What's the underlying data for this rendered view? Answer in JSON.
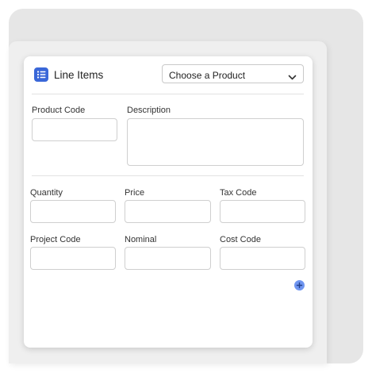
{
  "header": {
    "title": "Line Items",
    "icon": "list-icon",
    "accent_color": "#3a67d8"
  },
  "product_select": {
    "selected": "Choose a Product",
    "icon": "chevron-down-icon"
  },
  "fields": {
    "product_code": {
      "label": "Product Code",
      "value": ""
    },
    "description": {
      "label": "Description",
      "value": ""
    },
    "quantity": {
      "label": "Quantity",
      "value": ""
    },
    "price": {
      "label": "Price",
      "value": ""
    },
    "tax_code": {
      "label": "Tax Code",
      "value": ""
    },
    "project_code": {
      "label": "Project Code",
      "value": ""
    },
    "nominal": {
      "label": "Nominal",
      "value": ""
    },
    "cost_code": {
      "label": "Cost Code",
      "value": ""
    }
  },
  "add_button": {
    "icon": "plus-icon",
    "color": "#6f95f0"
  }
}
